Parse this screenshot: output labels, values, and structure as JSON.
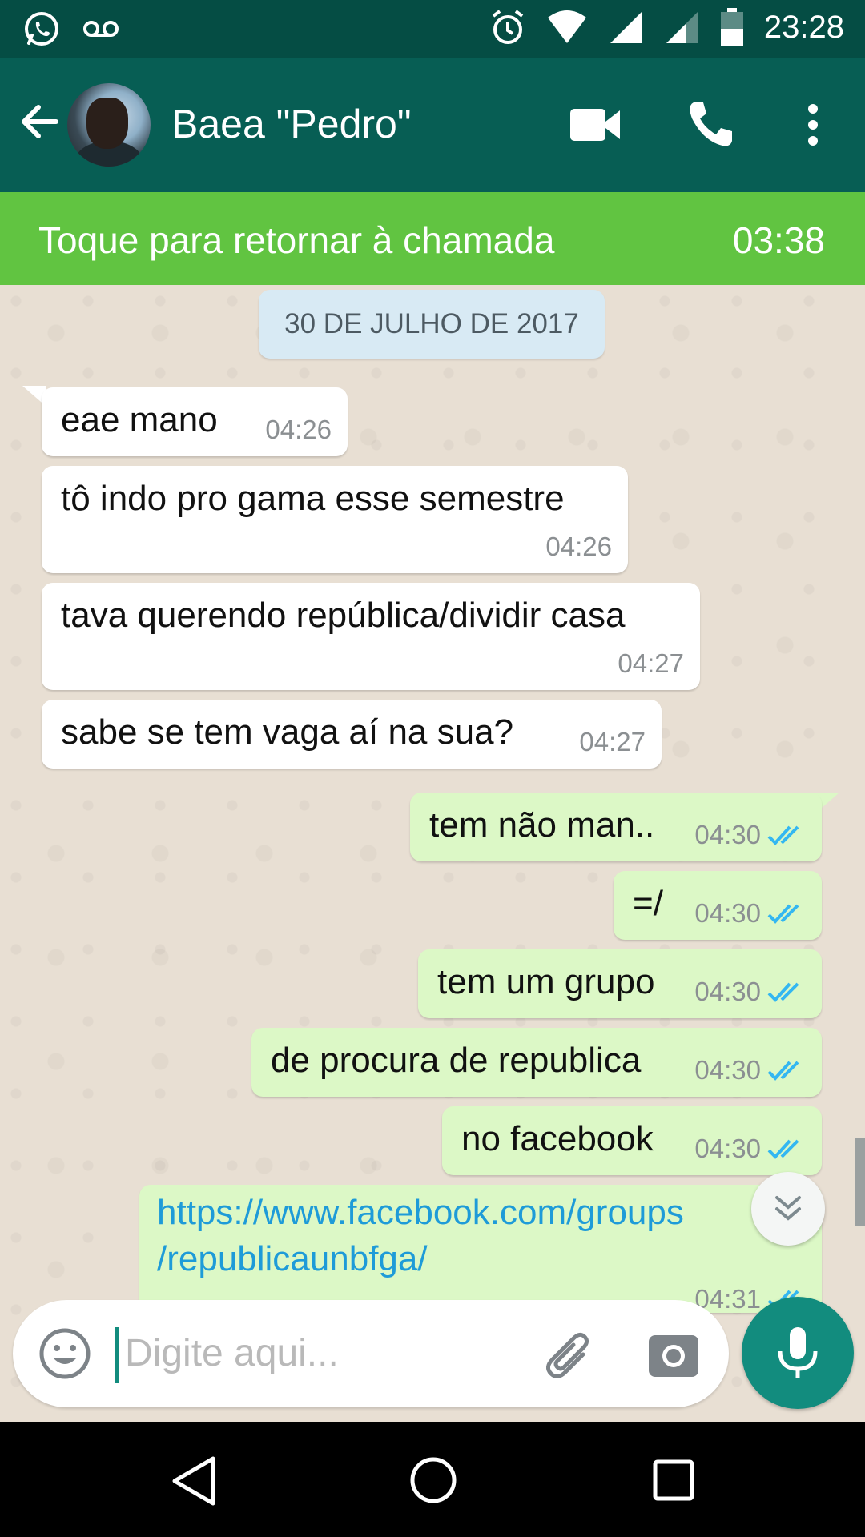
{
  "status_bar": {
    "time": "23:28",
    "icons": [
      "whatsapp-icon",
      "voicemail-icon",
      "alarm-icon",
      "wifi-icon",
      "signal-icon",
      "signal-icon-2",
      "battery-icon"
    ]
  },
  "header": {
    "contact_name": "Baea \"Pedro\"",
    "icons": [
      "back-arrow-icon",
      "avatar",
      "video-call-icon",
      "phone-call-icon",
      "more-options-icon"
    ]
  },
  "call_banner": {
    "label": "Toque para retornar à chamada",
    "timer": "03:38"
  },
  "chat": {
    "date_chip": "30 DE JULHO DE 2017",
    "incoming": [
      {
        "text": "eae mano",
        "time": "04:26"
      },
      {
        "text": "tô indo pro gama esse semestre",
        "time": "04:26"
      },
      {
        "text": "tava querendo república/dividir casa",
        "time": "04:27"
      },
      {
        "text": "sabe se tem vaga aí na sua?",
        "time": "04:27"
      }
    ],
    "outgoing": [
      {
        "text": "tem não man..",
        "time": "04:30"
      },
      {
        "text": "=/",
        "time": "04:30"
      },
      {
        "text": "tem um grupo",
        "time": "04:30"
      },
      {
        "text": "de procura de republica",
        "time": "04:30"
      },
      {
        "text": "no facebook",
        "time": "04:30"
      },
      {
        "text": "https://www.facebook.com/groups/republicaunbfga/",
        "line1": "https://www.facebook.com/groups",
        "line2": "/republicaunbfga/",
        "time": "04:31"
      }
    ],
    "read_tick_color": "#34b7f1"
  },
  "composer": {
    "placeholder": "Digite aqui...",
    "value": ""
  },
  "colors": {
    "header": "#075e54",
    "status": "#054d44",
    "call_banner": "#61c441",
    "outgoing_bubble": "#dcf8c6",
    "incoming_bubble": "#ffffff",
    "accent": "#128c7e"
  }
}
